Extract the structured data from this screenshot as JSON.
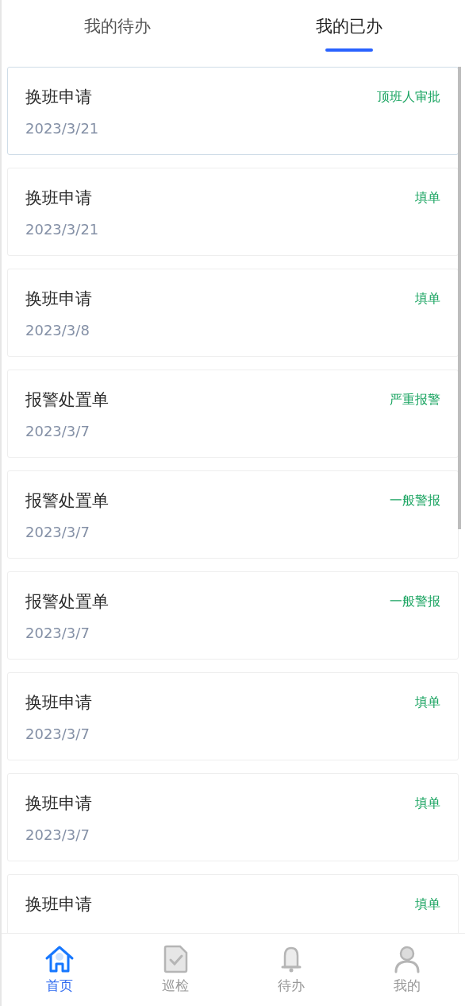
{
  "tabs": [
    {
      "label": "我的待办",
      "selected": false
    },
    {
      "label": "我的已办",
      "selected": true
    }
  ],
  "items": [
    {
      "title": "换班申请",
      "date": "2023/3/21",
      "status": "顶班人审批",
      "selected": true
    },
    {
      "title": "换班申请",
      "date": "2023/3/21",
      "status": "填单",
      "selected": false
    },
    {
      "title": "换班申请",
      "date": "2023/3/8",
      "status": "填单",
      "selected": false
    },
    {
      "title": "报警处置单",
      "date": "2023/3/7",
      "status": "严重报警",
      "selected": false
    },
    {
      "title": "报警处置单",
      "date": "2023/3/7",
      "status": "一般警报",
      "selected": false
    },
    {
      "title": "报警处置单",
      "date": "2023/3/7",
      "status": "一般警报",
      "selected": false
    },
    {
      "title": "换班申请",
      "date": "2023/3/7",
      "status": "填单",
      "selected": false
    },
    {
      "title": "换班申请",
      "date": "2023/3/7",
      "status": "填单",
      "selected": false
    },
    {
      "title": "换班申请",
      "status": "填单",
      "selected": false
    }
  ],
  "nav": [
    {
      "label": "首页",
      "kind": "home",
      "selected": true
    },
    {
      "label": "巡检",
      "kind": "inspect",
      "selected": false
    },
    {
      "label": "待办",
      "kind": "bell",
      "selected": false
    },
    {
      "label": "我的",
      "kind": "user",
      "selected": false
    }
  ]
}
